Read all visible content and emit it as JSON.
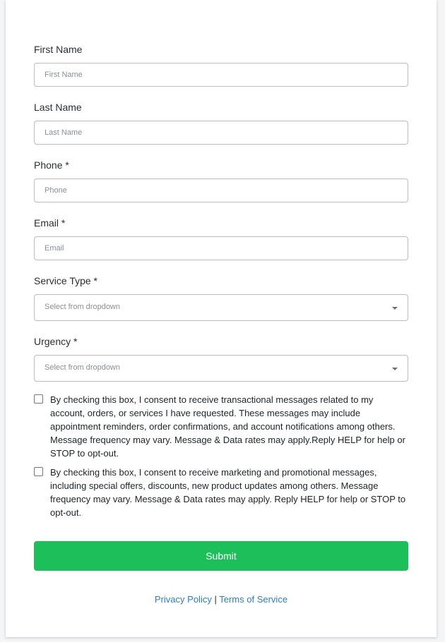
{
  "form": {
    "first_name": {
      "label": "First Name",
      "placeholder": "First Name"
    },
    "last_name": {
      "label": "Last Name",
      "placeholder": "Last Name"
    },
    "phone": {
      "label": "Phone *",
      "placeholder": "Phone"
    },
    "email": {
      "label": "Email *",
      "placeholder": "Email"
    },
    "service_type": {
      "label": "Service Type *",
      "placeholder": "Select from dropdown"
    },
    "urgency": {
      "label": "Urgency *",
      "placeholder": "Select from dropdown"
    }
  },
  "consent": {
    "transactional": "By checking this box, I consent to receive transactional messages related to my account, orders, or services I have requested. These messages may include appointment reminders, order confirmations, and account notifications among others. Message frequency may vary. Message & Data rates may apply.Reply HELP for help or STOP to opt-out.",
    "marketing": "By checking this box, I consent to receive marketing and promotional messages, including special offers, discounts, new product updates among others. Message frequency may vary. Message & Data rates may apply. Reply HELP for help or STOP to opt-out."
  },
  "submit_label": "Submit",
  "footer": {
    "privacy_policy": "Privacy Policy",
    "separator": "|",
    "terms_of_service": "Terms of Service"
  },
  "colors": {
    "submit_button": "#1cbf5a",
    "link": "#2a7ec8",
    "input_border": "#b9bdc2"
  }
}
